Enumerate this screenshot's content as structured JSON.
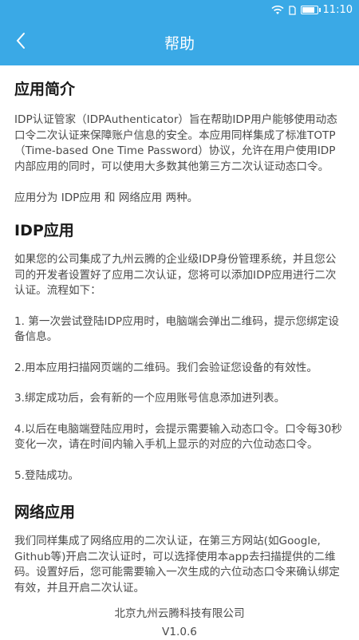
{
  "status_bar": {
    "time": "11:10",
    "battery_level": 0.9,
    "icons": [
      "wifi-icon",
      "sim-icon",
      "battery-icon"
    ]
  },
  "app_bar": {
    "title": "帮助",
    "back_icon": "chevron-left-icon",
    "color": "#3aa9e6"
  },
  "sections": [
    {
      "title": "应用简介",
      "paragraphs": [
        "IDP认证管家（IDPAuthenticator）旨在帮助IDP用户能够使用动态口令二次认证来保障账户信息的安全。本应用同样集成了标准TOTP（Time-based One Time Password）协议，允许在用户使用IDP内部应用的同时，可以使用大多数其他第三方二次认证动态口令。",
        "应用分为 IDP应用 和 网络应用 两种。"
      ]
    },
    {
      "title": "IDP应用",
      "paragraphs": [
        "如果您的公司集成了九州云腾的企业级IDP身份管理系统，并且您公司的开发者设置好了应用二次认证，您将可以添加IDP应用进行二次认证。流程如下：",
        "1. 第一次尝试登陆IDP应用时，电脑端会弹出二维码，提示您绑定设备信息。",
        "2.用本应用扫描网页端的二维码。我们会验证您设备的有效性。",
        "3.绑定成功后，会有新的一个应用账号信息添加进列表。",
        "4.以后在电脑端登陆应用时，会提示需要输入动态口令。口令每30秒变化一次，请在时间内输入手机上显示的对应的六位动态口令。",
        "5.登陆成功。"
      ]
    },
    {
      "title": "网络应用",
      "paragraphs": [
        "我们同样集成了网络应用的二次认证，在第三方网站(如Google, Github等)开启二次认证时，可以选择使用本app去扫描提供的二维码。设置好后，您可能需要输入一次生成的六位动态口令来确认绑定有效，并且开启二次认证。"
      ]
    }
  ],
  "footer": {
    "company": "北京九州云腾科技有限公司",
    "version": "V1.0.6"
  }
}
